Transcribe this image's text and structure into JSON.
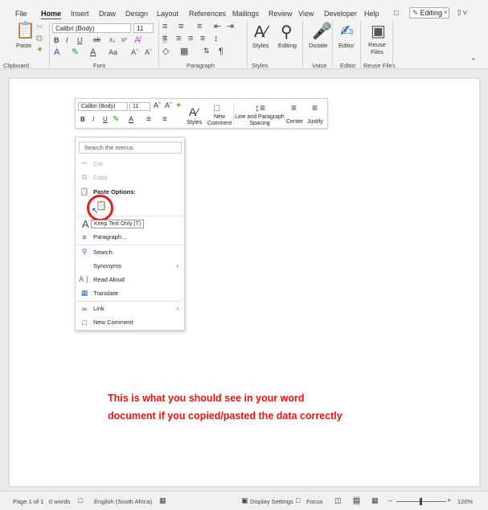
{
  "tabs": [
    "File",
    "Home",
    "Insert",
    "Draw",
    "Design",
    "Layout",
    "References",
    "Mailings",
    "Review",
    "View",
    "Developer",
    "Help"
  ],
  "active_tab": "Home",
  "editing_mode": "Editing",
  "ribbon": {
    "paste_label": "Paste",
    "font_name": "Calibri (Body)",
    "font_size": "11",
    "styles_label": "Styles",
    "editing_label": "Editing",
    "dictate_label": "Dictate",
    "editor_label": "Editor",
    "reuse_label": "Reuse Files",
    "groups": {
      "clipboard": "Clipboard",
      "font": "Font",
      "paragraph": "Paragraph",
      "styles": "Styles",
      "voice": "Voice",
      "editor": "Editor",
      "reuse": "Reuse Files"
    }
  },
  "mini_toolbar": {
    "font_name": "Calibri (Body)",
    "font_size": "11",
    "styles": "Styles",
    "new_comment": "New Comment",
    "line_spacing": "Line and Paragraph Spacing",
    "center": "Center",
    "justify": "Justify"
  },
  "context_menu": {
    "search_placeholder": "Search the menus",
    "cut": "Cut",
    "copy": "Copy",
    "paste_options": "Paste Options:",
    "paragraph": "Paragraph...",
    "search": "Search",
    "synonyms": "Synonyms",
    "read_aloud": "Read Aloud",
    "translate": "Translate",
    "link": "Link",
    "new_comment": "New Comment"
  },
  "tooltip": "Keep Text Only (T)",
  "annotation_line1": "This is what you should see in your word",
  "annotation_line2": "document if you copied/pasted the data correctly",
  "status": {
    "page": "Page 1 of 1",
    "words": "0 words",
    "language": "English (South Africa)",
    "display_settings": "Display Settings",
    "focus": "Focus",
    "zoom": "120%"
  },
  "colors": {
    "accent": "#185abd",
    "annotation": "#e8140f",
    "highlight_circle": "#e01f1f"
  }
}
